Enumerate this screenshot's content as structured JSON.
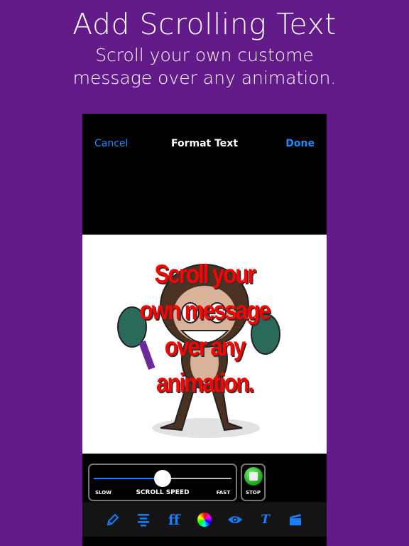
{
  "header": {
    "title": "Add Scrolling Text",
    "subtitle_line1": "Scroll your own custome",
    "subtitle_line2": "message over any animation."
  },
  "nav": {
    "cancel": "Cancel",
    "title": "Format Text",
    "done": "Done"
  },
  "preview": {
    "message_lines": [
      "Scroll your",
      "own message",
      "over any",
      "animation."
    ],
    "text_color": "#ff0000"
  },
  "speed": {
    "label": "SCROLL SPEED",
    "min_label": "SLOW",
    "max_label": "FAST",
    "value_percent": 50
  },
  "stop": {
    "label": "STOP"
  },
  "toolbar": {
    "items": [
      "pencil-icon",
      "align-center-icon",
      "font-icon",
      "color-wheel-icon",
      "eye-icon",
      "text-style-icon",
      "clapperboard-icon"
    ],
    "font_glyph": "ff",
    "accent": "#1a7cff"
  }
}
